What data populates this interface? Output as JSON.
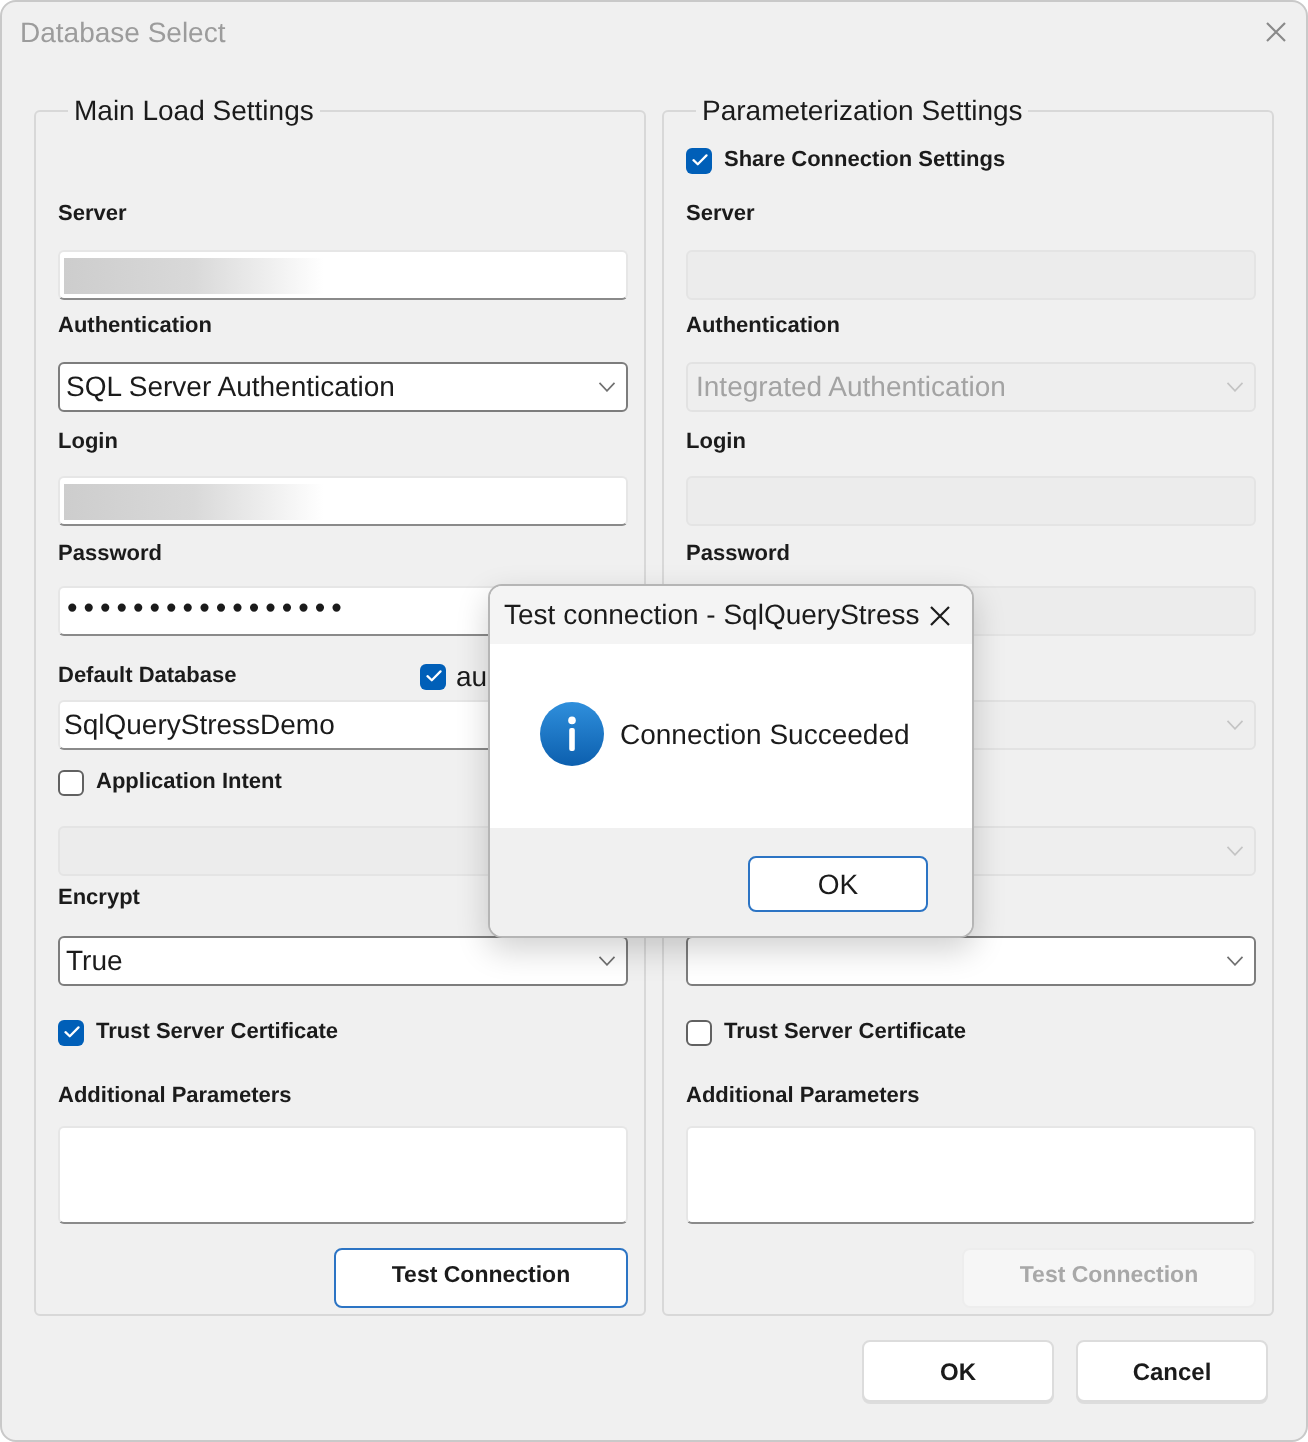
{
  "window": {
    "title": "Database Select",
    "active": false
  },
  "groups": [
    {
      "title": "Main Load Settings"
    },
    {
      "title": "Parameterization Settings"
    }
  ],
  "rows": [
    {
      "right": {
        "kind": "checkbox",
        "label": "Share Connection Settings",
        "checked": true
      }
    },
    {
      "left": {
        "kind": "label",
        "text": "Server"
      },
      "right": {
        "kind": "label",
        "text": "Server"
      }
    },
    {
      "left": {
        "kind": "field",
        "blurred": true,
        "disabled": false
      },
      "right": {
        "kind": "field",
        "disabled": true
      }
    },
    {
      "left": {
        "kind": "label",
        "text": "Authentication"
      },
      "right": {
        "kind": "label",
        "text": "Authentication"
      }
    },
    {
      "left": {
        "kind": "select",
        "value": "SQL Server Authentication",
        "disabled": false
      },
      "right": {
        "kind": "select",
        "value": "Integrated Authentication",
        "disabled": true
      }
    },
    {
      "left": {
        "kind": "label",
        "text": "Login"
      },
      "right": {
        "kind": "label",
        "text": "Login"
      }
    },
    {
      "left": {
        "kind": "field",
        "blurred": true,
        "disabled": false
      },
      "right": {
        "kind": "field",
        "disabled": true
      }
    },
    {
      "left": {
        "kind": "label",
        "text": "Password"
      },
      "right": {
        "kind": "label",
        "text": "Password"
      }
    },
    {
      "left": {
        "kind": "password",
        "value": "•••••••••••••••••",
        "disabled": false
      },
      "right": {
        "kind": "field",
        "disabled": true
      }
    },
    {
      "left": {
        "kind": "label",
        "text": "Default Database",
        "checkbox": {
          "label": "au",
          "checked": true
        }
      }
    },
    {
      "left": {
        "kind": "field",
        "value": "SqlQueryStressDemo",
        "disabled": false
      },
      "right": {
        "kind": "select",
        "disabled": true
      }
    },
    {
      "left": {
        "kind": "checkbox",
        "label": "Application Intent",
        "checked": false
      }
    },
    {
      "left": {
        "kind": "field",
        "disabled": true
      },
      "right": {
        "kind": "select",
        "disabled": true
      }
    },
    {
      "left": {
        "kind": "label",
        "text": "Encrypt"
      }
    },
    {
      "left": {
        "kind": "select",
        "value": "True",
        "disabled": false
      },
      "right": {
        "kind": "select",
        "disabled": false
      }
    },
    {
      "left": {
        "kind": "checkbox",
        "label": "Trust Server Certificate",
        "checked": true
      },
      "right": {
        "kind": "checkbox",
        "label": "Trust Server Certificate",
        "checked": false
      }
    },
    {
      "left": {
        "kind": "label",
        "text": "Additional Parameters"
      },
      "right": {
        "kind": "label",
        "text": "Additional Parameters"
      }
    },
    {
      "left": {
        "kind": "textarea"
      },
      "right": {
        "kind": "textarea"
      }
    },
    {
      "left": {
        "kind": "button",
        "label": "Test Connection",
        "focused": true,
        "disabled": false
      },
      "right": {
        "kind": "button",
        "label": "Test Connection",
        "disabled": true
      }
    }
  ],
  "buttons": [
    {
      "label": "OK"
    },
    {
      "label": "Cancel"
    }
  ],
  "dialog": {
    "title": "Test connection - SqlQueryStress",
    "message": "Connection Succeeded",
    "button": {
      "label": "OK",
      "focused": true
    }
  }
}
